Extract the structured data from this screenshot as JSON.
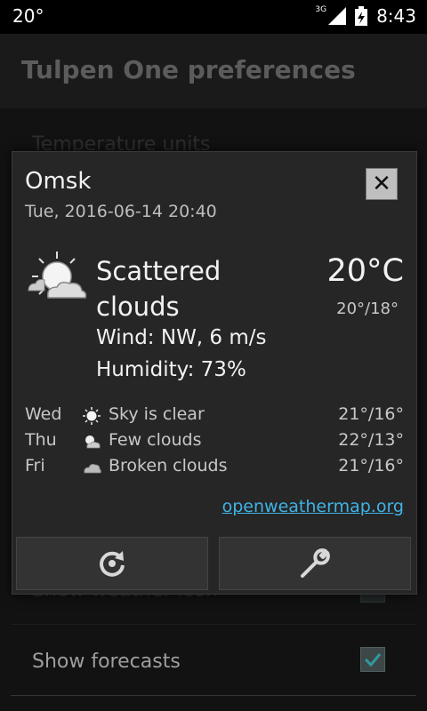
{
  "status_bar": {
    "temperature": "20°",
    "network": "3G",
    "time": "8:43"
  },
  "app": {
    "title": "Tulpen One preferences"
  },
  "background_prefs": {
    "item_top": "Temperature units",
    "item_mid": "Show weather icon",
    "item_bottom": "Show forecasts",
    "show_forecasts_checked": true
  },
  "dialog": {
    "city": "Omsk",
    "datetime": "Tue, 2016-06-14 20:40",
    "current": {
      "condition": "Scattered clouds",
      "icon": "scattered-clouds-icon",
      "wind": "Wind: NW, 6 m/s",
      "humidity": "Humidity: 73%",
      "temperature": "20°C",
      "range": "20°/18°"
    },
    "forecast": [
      {
        "day": "Wed",
        "icon": "sun-icon",
        "text": "Sky is clear",
        "temp": "21°/16°"
      },
      {
        "day": "Thu",
        "icon": "few-clouds-icon",
        "text": "Few clouds",
        "temp": "22°/13°"
      },
      {
        "day": "Fri",
        "icon": "broken-clouds-icon",
        "text": "Broken clouds",
        "temp": "21°/16°"
      }
    ],
    "link": "openweathermap.org",
    "close_label": "✕",
    "accent_link_color": "#3fb3e6"
  }
}
